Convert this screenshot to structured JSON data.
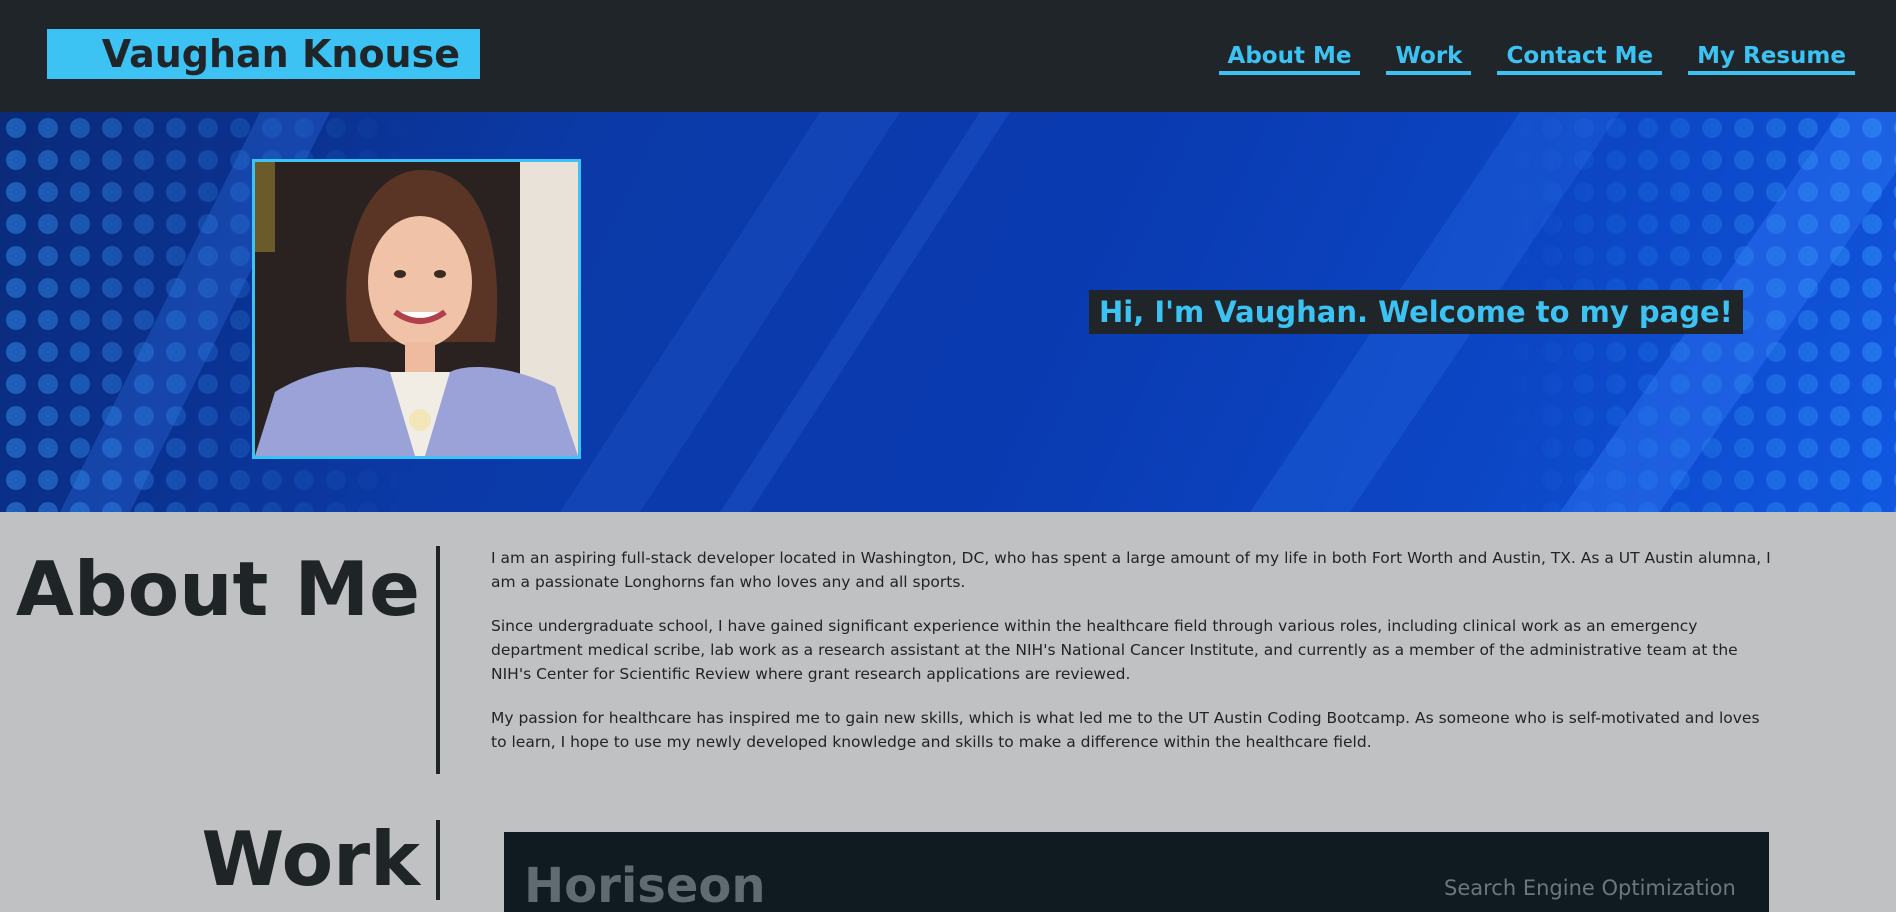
{
  "header": {
    "name": "Vaughan Knouse",
    "nav": [
      {
        "label": "About Me"
      },
      {
        "label": "Work"
      },
      {
        "label": "Contact Me"
      },
      {
        "label": "My Resume"
      }
    ]
  },
  "hero": {
    "welcome": "Hi, I'm Vaughan. Welcome to my page!"
  },
  "about": {
    "title": "About Me",
    "paragraphs": [
      "I am an aspiring full-stack developer located in Washington, DC, who has spent a large amount of my life in both Fort Worth and Austin, TX. As a UT Austin alumna, I am a passionate Longhorns fan who loves any and all sports.",
      "Since undergraduate school, I have gained significant experience within the healthcare field through various roles, including clinical work as an emergency department medical scribe, lab work as a research assistant at the NIH's National Cancer Institute, and currently as a member of the administrative team at the NIH's Center for Scientific Review where grant research applications are reviewed.",
      "My passion for healthcare has inspired me to gain new skills, which is what led me to the UT Austin Coding Bootcamp. As someone who is self-motivated and loves to learn, I hope to use my newly developed knowledge and skills to make a difference within the healthcare field."
    ]
  },
  "work": {
    "title": "Work",
    "project_preview": {
      "logo": "Horiseon",
      "menu": "Search Engine Optimization"
    }
  },
  "colors": {
    "accent": "#3dc3f3",
    "header_bg": "#1f2528",
    "page_bg": "#c0c1c3"
  }
}
